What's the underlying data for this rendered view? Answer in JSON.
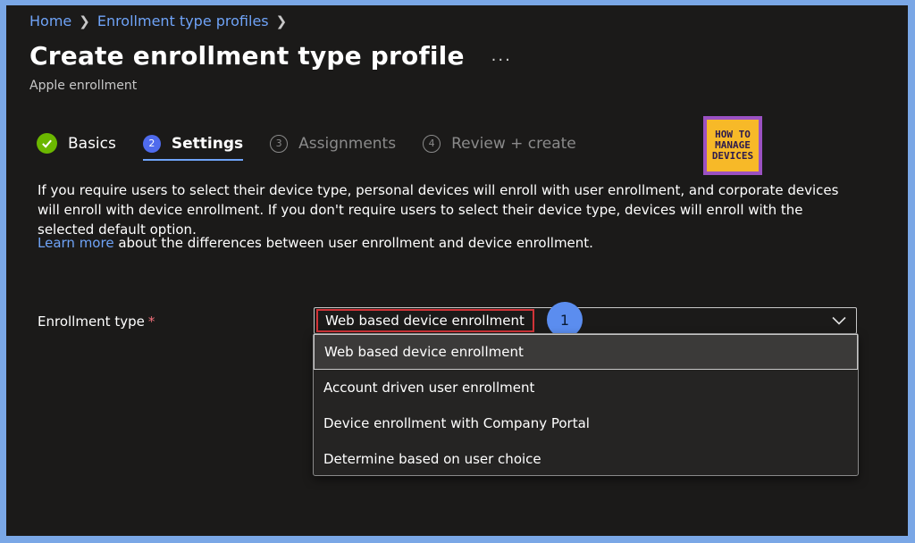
{
  "breadcrumb": {
    "items": [
      "Home",
      "Enrollment type profiles"
    ]
  },
  "header": {
    "title": "Create enrollment type profile",
    "more": "...",
    "subtitle": "Apple enrollment"
  },
  "steps": [
    {
      "num": "",
      "label": "Basics",
      "state": "done"
    },
    {
      "num": "2",
      "label": "Settings",
      "state": "active"
    },
    {
      "num": "3",
      "label": "Assignments",
      "state": "inactive"
    },
    {
      "num": "4",
      "label": "Review + create",
      "state": "inactive"
    }
  ],
  "logo": {
    "line1": "HOW TO",
    "line2": "MANAGE",
    "line3": "DEVICES"
  },
  "description": "If you require users to select their device type, personal devices will enroll with user enrollment, and corporate devices will enroll with device enrollment. If you don't require users to select their device type, devices will enroll with the selected default option.",
  "learn_more": {
    "link": "Learn more",
    "text": " about the differences between user enrollment and device enrollment."
  },
  "enrollment_type": {
    "label": "Enrollment type",
    "required": "*",
    "selected": "Web based device enrollment",
    "options": [
      "Web based device enrollment",
      "Account driven user enrollment",
      "Device enrollment with Company Portal",
      "Determine based on user choice"
    ]
  },
  "callout": {
    "number": "1"
  },
  "colors": {
    "accent": "#6fa3f7",
    "done": "#6bb700",
    "active_step": "#4f6bed",
    "highlight": "#d13438",
    "background": "#1b1a19"
  }
}
